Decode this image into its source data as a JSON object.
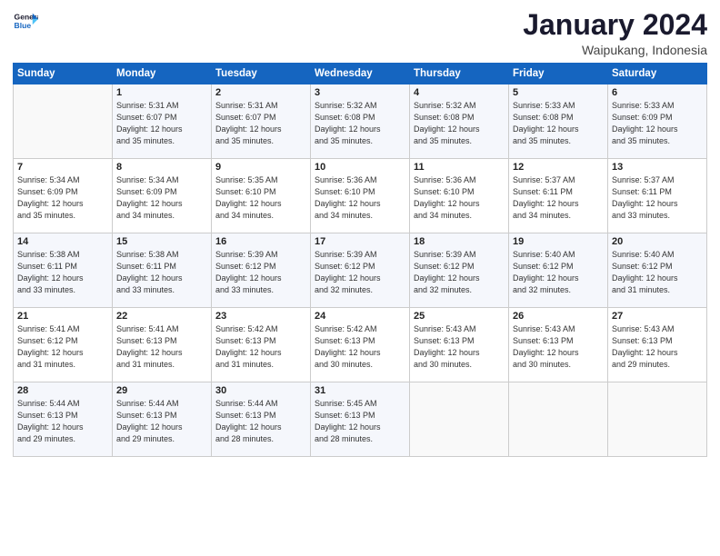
{
  "logo": {
    "line1": "General",
    "line2": "Blue"
  },
  "header": {
    "month": "January 2024",
    "location": "Waipukang, Indonesia"
  },
  "weekdays": [
    "Sunday",
    "Monday",
    "Tuesday",
    "Wednesday",
    "Thursday",
    "Friday",
    "Saturday"
  ],
  "weeks": [
    [
      {
        "day": "",
        "info": ""
      },
      {
        "day": "1",
        "info": "Sunrise: 5:31 AM\nSunset: 6:07 PM\nDaylight: 12 hours\nand 35 minutes."
      },
      {
        "day": "2",
        "info": "Sunrise: 5:31 AM\nSunset: 6:07 PM\nDaylight: 12 hours\nand 35 minutes."
      },
      {
        "day": "3",
        "info": "Sunrise: 5:32 AM\nSunset: 6:08 PM\nDaylight: 12 hours\nand 35 minutes."
      },
      {
        "day": "4",
        "info": "Sunrise: 5:32 AM\nSunset: 6:08 PM\nDaylight: 12 hours\nand 35 minutes."
      },
      {
        "day": "5",
        "info": "Sunrise: 5:33 AM\nSunset: 6:08 PM\nDaylight: 12 hours\nand 35 minutes."
      },
      {
        "day": "6",
        "info": "Sunrise: 5:33 AM\nSunset: 6:09 PM\nDaylight: 12 hours\nand 35 minutes."
      }
    ],
    [
      {
        "day": "7",
        "info": "Sunrise: 5:34 AM\nSunset: 6:09 PM\nDaylight: 12 hours\nand 35 minutes."
      },
      {
        "day": "8",
        "info": "Sunrise: 5:34 AM\nSunset: 6:09 PM\nDaylight: 12 hours\nand 34 minutes."
      },
      {
        "day": "9",
        "info": "Sunrise: 5:35 AM\nSunset: 6:10 PM\nDaylight: 12 hours\nand 34 minutes."
      },
      {
        "day": "10",
        "info": "Sunrise: 5:36 AM\nSunset: 6:10 PM\nDaylight: 12 hours\nand 34 minutes."
      },
      {
        "day": "11",
        "info": "Sunrise: 5:36 AM\nSunset: 6:10 PM\nDaylight: 12 hours\nand 34 minutes."
      },
      {
        "day": "12",
        "info": "Sunrise: 5:37 AM\nSunset: 6:11 PM\nDaylight: 12 hours\nand 34 minutes."
      },
      {
        "day": "13",
        "info": "Sunrise: 5:37 AM\nSunset: 6:11 PM\nDaylight: 12 hours\nand 33 minutes."
      }
    ],
    [
      {
        "day": "14",
        "info": "Sunrise: 5:38 AM\nSunset: 6:11 PM\nDaylight: 12 hours\nand 33 minutes."
      },
      {
        "day": "15",
        "info": "Sunrise: 5:38 AM\nSunset: 6:11 PM\nDaylight: 12 hours\nand 33 minutes."
      },
      {
        "day": "16",
        "info": "Sunrise: 5:39 AM\nSunset: 6:12 PM\nDaylight: 12 hours\nand 33 minutes."
      },
      {
        "day": "17",
        "info": "Sunrise: 5:39 AM\nSunset: 6:12 PM\nDaylight: 12 hours\nand 32 minutes."
      },
      {
        "day": "18",
        "info": "Sunrise: 5:39 AM\nSunset: 6:12 PM\nDaylight: 12 hours\nand 32 minutes."
      },
      {
        "day": "19",
        "info": "Sunrise: 5:40 AM\nSunset: 6:12 PM\nDaylight: 12 hours\nand 32 minutes."
      },
      {
        "day": "20",
        "info": "Sunrise: 5:40 AM\nSunset: 6:12 PM\nDaylight: 12 hours\nand 31 minutes."
      }
    ],
    [
      {
        "day": "21",
        "info": "Sunrise: 5:41 AM\nSunset: 6:12 PM\nDaylight: 12 hours\nand 31 minutes."
      },
      {
        "day": "22",
        "info": "Sunrise: 5:41 AM\nSunset: 6:13 PM\nDaylight: 12 hours\nand 31 minutes."
      },
      {
        "day": "23",
        "info": "Sunrise: 5:42 AM\nSunset: 6:13 PM\nDaylight: 12 hours\nand 31 minutes."
      },
      {
        "day": "24",
        "info": "Sunrise: 5:42 AM\nSunset: 6:13 PM\nDaylight: 12 hours\nand 30 minutes."
      },
      {
        "day": "25",
        "info": "Sunrise: 5:43 AM\nSunset: 6:13 PM\nDaylight: 12 hours\nand 30 minutes."
      },
      {
        "day": "26",
        "info": "Sunrise: 5:43 AM\nSunset: 6:13 PM\nDaylight: 12 hours\nand 30 minutes."
      },
      {
        "day": "27",
        "info": "Sunrise: 5:43 AM\nSunset: 6:13 PM\nDaylight: 12 hours\nand 29 minutes."
      }
    ],
    [
      {
        "day": "28",
        "info": "Sunrise: 5:44 AM\nSunset: 6:13 PM\nDaylight: 12 hours\nand 29 minutes."
      },
      {
        "day": "29",
        "info": "Sunrise: 5:44 AM\nSunset: 6:13 PM\nDaylight: 12 hours\nand 29 minutes."
      },
      {
        "day": "30",
        "info": "Sunrise: 5:44 AM\nSunset: 6:13 PM\nDaylight: 12 hours\nand 28 minutes."
      },
      {
        "day": "31",
        "info": "Sunrise: 5:45 AM\nSunset: 6:13 PM\nDaylight: 12 hours\nand 28 minutes."
      },
      {
        "day": "",
        "info": ""
      },
      {
        "day": "",
        "info": ""
      },
      {
        "day": "",
        "info": ""
      }
    ]
  ]
}
